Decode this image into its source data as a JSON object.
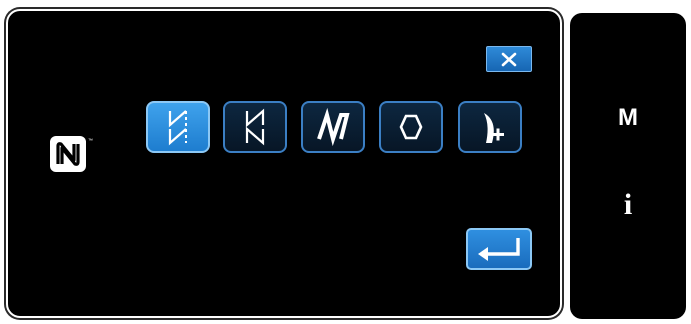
{
  "main_panel": {
    "close_button": {
      "icon": "close-icon"
    },
    "pattern_buttons": [
      {
        "icon": "pattern-bartack-dashed-icon",
        "selected": true
      },
      {
        "icon": "pattern-bartack-icon",
        "selected": false
      },
      {
        "icon": "pattern-zigzag-m-icon",
        "selected": false
      },
      {
        "icon": "pattern-hexagon-icon",
        "selected": false
      },
      {
        "icon": "pattern-custom-add-icon",
        "selected": false
      }
    ],
    "nfc_icon": {
      "icon": "nfc-icon"
    },
    "enter_button": {
      "icon": "enter-return-icon"
    }
  },
  "side_panel": {
    "mode_label": "M",
    "info_label": "i"
  },
  "colors": {
    "background": "#000000",
    "accent": "#1e7dcf",
    "button_border": "#3b7fc4"
  }
}
